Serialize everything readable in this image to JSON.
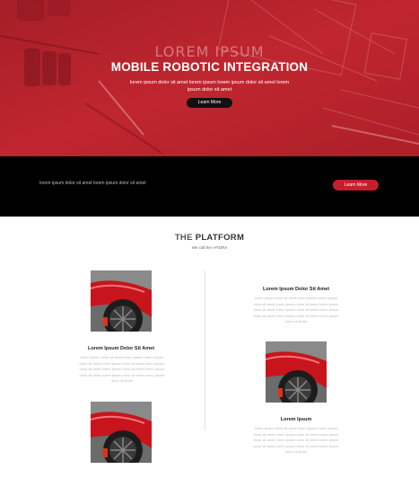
{
  "hero": {
    "eyebrow": "LOREM IPSUM",
    "title": "MOBILE ROBOTIC INTEGRATION",
    "subtitle": "lorem ipsum dolor sit amet lorem ipsum lorem ipsum dolor sit amet lorem ipsum dolor sit amet",
    "button_label": "Learn More",
    "accent_color": "#b8232c"
  },
  "band": {
    "text": "lorem ipsum dolor sit amet lorem ipsum dolor sit amet",
    "button_label": "Learn More",
    "button_color": "#c4202b"
  },
  "platform": {
    "title_part1": "THE",
    "title_part2": "PLATFORM",
    "subtitle": "We call her HYDRA",
    "cards": [
      {
        "title": "Lorem Ipsum Dolor Sit Amet",
        "text": "lorem ipsum dolor sit amet lorem ipsum lorem ipsum dolor sit amet lorem ipsum dolor sit amet lorem ipsum dolor sit amet lorem ipsum dolor sit amet lorem ipsum dolor sit amet lorem ipsum dolor sit amet lorem ipsum dolor sit amet"
      },
      {
        "title": "Lorem Ipsum Dolor Sit Amet",
        "text": "lorem ipsum dolor sit amet lorem ipsum lorem ipsum dolor sit amet lorem ipsum dolor sit amet lorem ipsum dolor sit amet lorem ipsum dolor sit amet lorem ipsum dolor sit amet lorem ipsum dolor sit amet lorem ipsum dolor sit amet"
      },
      {
        "title": "Lorem Ipsum",
        "text": "lorem ipsum dolor sit amet lorem ipsum lorem ipsum dolor sit amet lorem ipsum dolor sit amet lorem ipsum dolor sit amet lorem ipsum dolor sit amet lorem ipsum dolor sit amet lorem ipsum dolor sit amet lorem ipsum dolor sit amet"
      }
    ],
    "car_color": "#c8141c"
  }
}
